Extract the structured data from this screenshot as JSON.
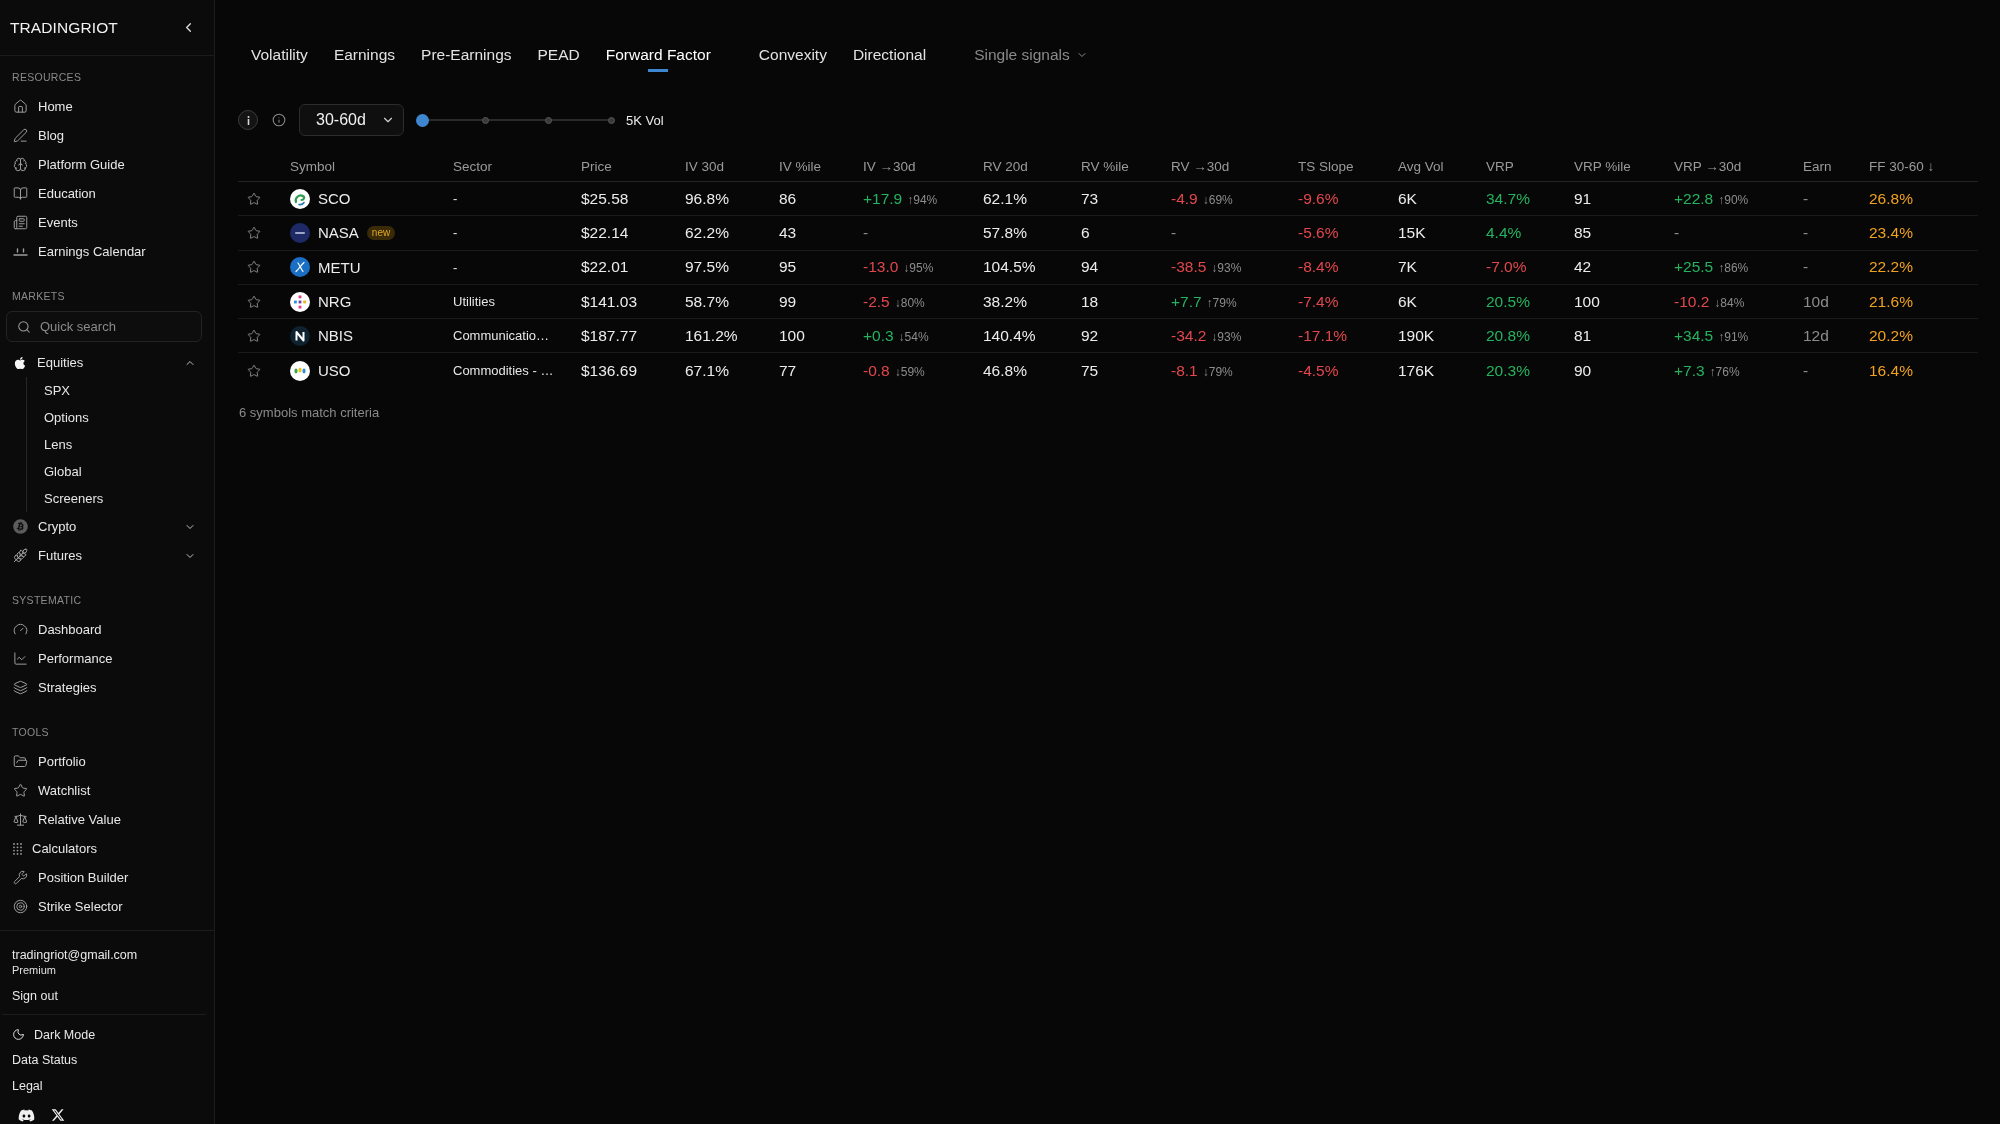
{
  "sidebar": {
    "brand": "TRADINGRIOT",
    "sections": [
      {
        "title": "RESOURCES",
        "items": [
          {
            "label": "Home"
          },
          {
            "label": "Blog"
          },
          {
            "label": "Platform Guide"
          },
          {
            "label": "Education"
          },
          {
            "label": "Events"
          },
          {
            "label": "Earnings Calendar"
          }
        ]
      },
      {
        "title": "MARKETS",
        "search": {
          "placeholder": "Quick search"
        },
        "items": [
          {
            "label": "Equities",
            "expanded": true,
            "children": [
              {
                "label": "SPX"
              },
              {
                "label": "Options"
              },
              {
                "label": "Lens"
              },
              {
                "label": "Global"
              },
              {
                "label": "Screeners"
              }
            ]
          },
          {
            "label": "Crypto",
            "expanded": false
          },
          {
            "label": "Futures",
            "expanded": false
          }
        ]
      },
      {
        "title": "SYSTEMATIC",
        "items": [
          {
            "label": "Dashboard"
          },
          {
            "label": "Performance"
          },
          {
            "label": "Strategies"
          }
        ]
      },
      {
        "title": "TOOLS",
        "items": [
          {
            "label": "Portfolio"
          },
          {
            "label": "Watchlist"
          },
          {
            "label": "Relative Value"
          },
          {
            "label": "Calculators"
          },
          {
            "label": "Position Builder"
          },
          {
            "label": "Strike Selector"
          }
        ]
      }
    ],
    "account": {
      "email": "tradingriot@gmail.com",
      "plan": "Premium",
      "sign_out": "Sign out"
    },
    "footer_links": [
      {
        "label": "Dark Mode",
        "kind": "toggle"
      },
      {
        "label": "Data Status",
        "kind": "link"
      },
      {
        "label": "Legal",
        "kind": "link"
      }
    ]
  },
  "tab_groups": [
    [
      {
        "label": "Volatility",
        "selected": false
      },
      {
        "label": "Earnings",
        "selected": false
      },
      {
        "label": "Pre-Earnings",
        "selected": false
      },
      {
        "label": "PEAD",
        "selected": false
      },
      {
        "label": "Forward Factor",
        "selected": true
      }
    ],
    [
      {
        "label": "Convexity",
        "selected": false
      },
      {
        "label": "Directional",
        "selected": false
      }
    ]
  ],
  "signals_menu": {
    "label": "Single signals"
  },
  "filters": {
    "period": {
      "value": "30-60d"
    },
    "volume": {
      "level": 0,
      "label": "5K Vol"
    }
  },
  "table": {
    "columns": [
      "Symbol",
      "Sector",
      "Price",
      "IV 30d",
      "IV %ile",
      "IV →30d",
      "RV 20d",
      "RV %ile",
      "RV →30d",
      "TS Slope",
      "Avg Vol",
      "VRP",
      "VRP %ile",
      "VRP →30d",
      "Earn",
      "FF 30-60 ↓"
    ],
    "rows": [
      {
        "starred": false,
        "symbol": "SCO",
        "sector": "-",
        "values": [
          {
            "text": "$25.58",
            "kind": "plain"
          },
          {
            "text": "96.8%",
            "kind": "plain"
          },
          {
            "text": "86",
            "kind": "plain"
          },
          {
            "text": "+17.9",
            "kind": "up",
            "sub": "↑94%"
          },
          {
            "text": "62.1%",
            "kind": "plain"
          },
          {
            "text": "73",
            "kind": "plain"
          },
          {
            "text": "-4.9",
            "kind": "down",
            "sub": "↓69%"
          },
          {
            "text": "-9.6%",
            "kind": "down"
          },
          {
            "text": "6K",
            "kind": "plain"
          },
          {
            "text": "34.7%",
            "kind": "up"
          },
          {
            "text": "91",
            "kind": "plain"
          },
          {
            "text": "+22.8",
            "kind": "up",
            "sub": "↑90%"
          },
          {
            "text": "-",
            "kind": "muted"
          },
          {
            "text": "26.8%",
            "kind": "highlight"
          }
        ]
      },
      {
        "starred": false,
        "symbol": "NASA",
        "badge": "new",
        "sector": "-",
        "values": [
          {
            "text": "$22.14",
            "kind": "plain"
          },
          {
            "text": "62.2%",
            "kind": "plain"
          },
          {
            "text": "43",
            "kind": "plain"
          },
          {
            "text": "-",
            "kind": "muted"
          },
          {
            "text": "57.8%",
            "kind": "plain"
          },
          {
            "text": "6",
            "kind": "plain"
          },
          {
            "text": "-",
            "kind": "muted"
          },
          {
            "text": "-5.6%",
            "kind": "down"
          },
          {
            "text": "15K",
            "kind": "plain"
          },
          {
            "text": "4.4%",
            "kind": "up"
          },
          {
            "text": "85",
            "kind": "plain"
          },
          {
            "text": "-",
            "kind": "muted"
          },
          {
            "text": "-",
            "kind": "muted"
          },
          {
            "text": "23.4%",
            "kind": "highlight"
          }
        ]
      },
      {
        "starred": false,
        "symbol": "METU",
        "sector": "-",
        "values": [
          {
            "text": "$22.01",
            "kind": "plain"
          },
          {
            "text": "97.5%",
            "kind": "plain"
          },
          {
            "text": "95",
            "kind": "plain"
          },
          {
            "text": "-13.0",
            "kind": "down",
            "sub": "↓95%"
          },
          {
            "text": "104.5%",
            "kind": "plain"
          },
          {
            "text": "94",
            "kind": "plain"
          },
          {
            "text": "-38.5",
            "kind": "down",
            "sub": "↓93%"
          },
          {
            "text": "-8.4%",
            "kind": "down"
          },
          {
            "text": "7K",
            "kind": "plain"
          },
          {
            "text": "-7.0%",
            "kind": "down"
          },
          {
            "text": "42",
            "kind": "plain"
          },
          {
            "text": "+25.5",
            "kind": "up",
            "sub": "↑86%"
          },
          {
            "text": "-",
            "kind": "muted"
          },
          {
            "text": "22.2%",
            "kind": "highlight"
          }
        ]
      },
      {
        "starred": false,
        "symbol": "NRG",
        "sector": "Utilities",
        "values": [
          {
            "text": "$141.03",
            "kind": "plain"
          },
          {
            "text": "58.7%",
            "kind": "plain"
          },
          {
            "text": "99",
            "kind": "plain"
          },
          {
            "text": "-2.5",
            "kind": "down",
            "sub": "↓80%"
          },
          {
            "text": "38.2%",
            "kind": "plain"
          },
          {
            "text": "18",
            "kind": "plain"
          },
          {
            "text": "+7.7",
            "kind": "up",
            "sub": "↑79%"
          },
          {
            "text": "-7.4%",
            "kind": "down"
          },
          {
            "text": "6K",
            "kind": "plain"
          },
          {
            "text": "20.5%",
            "kind": "up"
          },
          {
            "text": "100",
            "kind": "plain"
          },
          {
            "text": "-10.2",
            "kind": "down",
            "sub": "↓84%"
          },
          {
            "text": "10d",
            "kind": "muted"
          },
          {
            "text": "21.6%",
            "kind": "highlight"
          }
        ]
      },
      {
        "starred": false,
        "symbol": "NBIS",
        "sector": "Communicatio…",
        "values": [
          {
            "text": "$187.77",
            "kind": "plain"
          },
          {
            "text": "161.2%",
            "kind": "plain"
          },
          {
            "text": "100",
            "kind": "plain"
          },
          {
            "text": "+0.3",
            "kind": "up",
            "sub": "↓54%"
          },
          {
            "text": "140.4%",
            "kind": "plain"
          },
          {
            "text": "92",
            "kind": "plain"
          },
          {
            "text": "-34.2",
            "kind": "down",
            "sub": "↓93%"
          },
          {
            "text": "-17.1%",
            "kind": "down"
          },
          {
            "text": "190K",
            "kind": "plain"
          },
          {
            "text": "20.8%",
            "kind": "up"
          },
          {
            "text": "81",
            "kind": "plain"
          },
          {
            "text": "+34.5",
            "kind": "up",
            "sub": "↑91%"
          },
          {
            "text": "12d",
            "kind": "muted"
          },
          {
            "text": "20.2%",
            "kind": "highlight"
          }
        ]
      },
      {
        "starred": false,
        "symbol": "USO",
        "sector": "Commodities - …",
        "values": [
          {
            "text": "$136.69",
            "kind": "plain"
          },
          {
            "text": "67.1%",
            "kind": "plain"
          },
          {
            "text": "77",
            "kind": "plain"
          },
          {
            "text": "-0.8",
            "kind": "down",
            "sub": "↓59%"
          },
          {
            "text": "46.8%",
            "kind": "plain"
          },
          {
            "text": "75",
            "kind": "plain"
          },
          {
            "text": "-8.1",
            "kind": "down",
            "sub": "↓79%"
          },
          {
            "text": "-4.5%",
            "kind": "down"
          },
          {
            "text": "176K",
            "kind": "plain"
          },
          {
            "text": "20.3%",
            "kind": "up"
          },
          {
            "text": "90",
            "kind": "plain"
          },
          {
            "text": "+7.3",
            "kind": "up",
            "sub": "↑76%"
          },
          {
            "text": "-",
            "kind": "muted"
          },
          {
            "text": "16.4%",
            "kind": "highlight"
          }
        ]
      }
    ]
  },
  "result_count": "6 symbols match criteria"
}
